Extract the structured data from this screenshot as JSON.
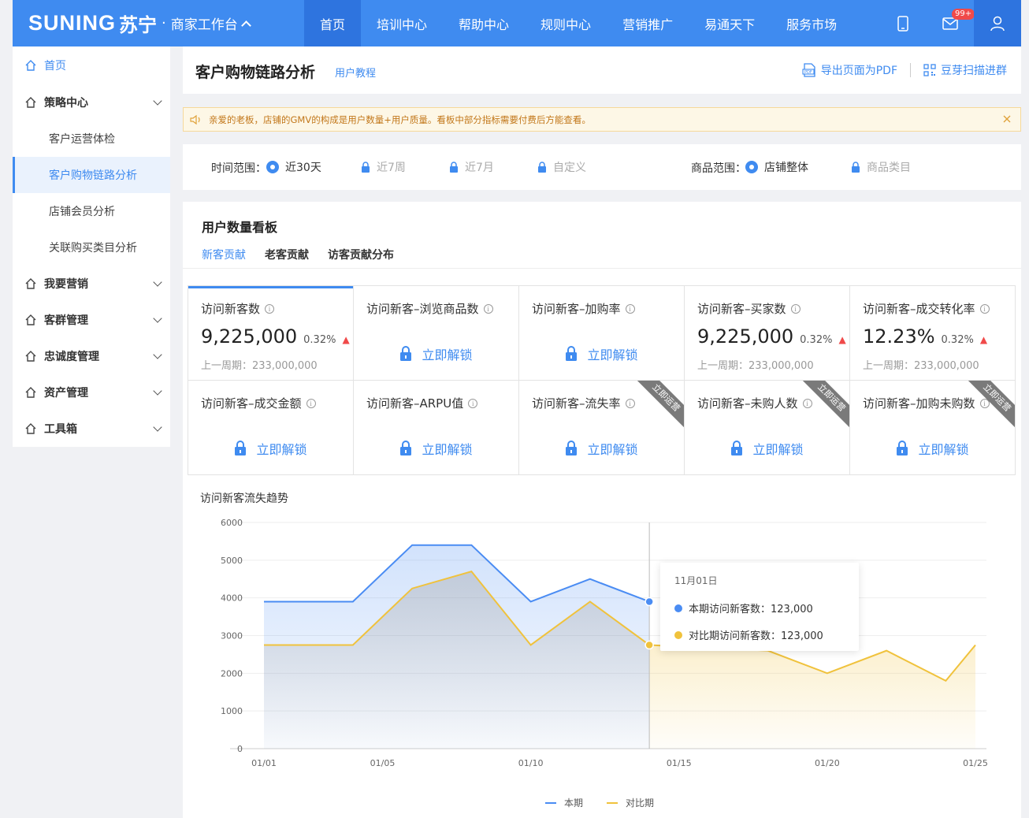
{
  "topbar": {
    "brand": "SUNING",
    "brand_cn": "苏宁",
    "subtitle": "商家工作台",
    "nav": [
      "首页",
      "培训中心",
      "帮助中心",
      "规则中心",
      "营销推广",
      "易通天下",
      "服务市场"
    ],
    "mail_badge": "99+"
  },
  "sidebar": {
    "home": "首页",
    "groups": [
      {
        "label": "策略中心",
        "items": [
          "客户运营体检",
          "客户购物链路分析",
          "店铺会员分析",
          "关联购买类目分析"
        ]
      },
      {
        "label": "我要营销"
      },
      {
        "label": "客群管理"
      },
      {
        "label": "忠诚度管理"
      },
      {
        "label": "资产管理"
      },
      {
        "label": "工具箱"
      }
    ]
  },
  "header": {
    "title": "客户购物链路分析",
    "tutorial": "用户教程",
    "export_pdf": "导出页面为PDF",
    "scan_group": "豆芽扫描进群"
  },
  "notice": "亲爱的老板，店铺的GMV的构成是用户数量+用户质量。看板中部分指标需要付费后方能查看。",
  "filters": {
    "time_label": "时间范围：",
    "time_options": [
      "近30天",
      "近7周",
      "近7月",
      "自定义"
    ],
    "product_label": "商品范围：",
    "product_options": [
      "店铺整体",
      "商品类目"
    ]
  },
  "board": {
    "title": "用户数量看板",
    "tabs": [
      "新客贡献",
      "老客贡献",
      "访客贡献分布"
    ],
    "unlock_label": "立即解锁",
    "ribbon_label": "立即运营",
    "cells": [
      {
        "title": "访问新客数",
        "value": "9,225,000",
        "change": "0.32%",
        "prev": "上一周期：233,000,000"
      },
      {
        "title": "访问新客–浏览商品数"
      },
      {
        "title": "访问新客–加购率"
      },
      {
        "title": "访问新客–买家数",
        "value": "9,225,000",
        "change": "0.32%",
        "prev": "上一周期：233,000,000"
      },
      {
        "title": "访问新客–成交转化率",
        "value": "12.23%",
        "change": "0.32%",
        "prev": "上一周期：233,000,000"
      },
      {
        "title": "访问新客–成交金额"
      },
      {
        "title": "访问新客–ARPU值"
      },
      {
        "title": "访问新客–流失率"
      },
      {
        "title": "访问新客–未购人数"
      },
      {
        "title": "访问新客–加购未购数"
      }
    ]
  },
  "chart_data": {
    "type": "area",
    "title": "访问新客流失趋势",
    "x": [
      "01/01",
      "01/02",
      "01/03",
      "01/04",
      "01/05",
      "01/06",
      "01/07",
      "01/08",
      "01/09",
      "01/10",
      "01/11",
      "01/12",
      "01/13",
      "01/14",
      "01/15",
      "01/16",
      "01/17",
      "01/18",
      "01/19",
      "01/20",
      "01/21",
      "01/22",
      "01/23",
      "01/24",
      "01/25"
    ],
    "x_ticks": [
      "01/01",
      "01/05",
      "01/10",
      "01/15",
      "01/20",
      "01/25"
    ],
    "ylim": [
      0,
      6000
    ],
    "y_ticks": [
      0,
      1000,
      2000,
      3000,
      4000,
      5000,
      6000
    ],
    "series": [
      {
        "name": "本期",
        "color": "#4a8cf3",
        "values": [
          3900,
          null,
          null,
          3900,
          null,
          5400,
          null,
          5400,
          null,
          3900,
          null,
          4500,
          null,
          3900
        ]
      },
      {
        "name": "对比期",
        "color": "#f0c23c",
        "values": [
          2750,
          null,
          null,
          2750,
          null,
          4250,
          null,
          4700,
          null,
          2750,
          null,
          3900,
          null,
          2750,
          null,
          null,
          null,
          2600,
          null,
          2000,
          null,
          2600,
          null,
          1800,
          2750
        ]
      }
    ],
    "tooltip": {
      "date": "11月01日",
      "rows": [
        {
          "label": "本期访问新客数：123,000",
          "color": "#4a8cf3"
        },
        {
          "label": "对比期访问新客数：123,000",
          "color": "#f0c23c"
        }
      ]
    },
    "legend": [
      "本期",
      "对比期"
    ]
  }
}
